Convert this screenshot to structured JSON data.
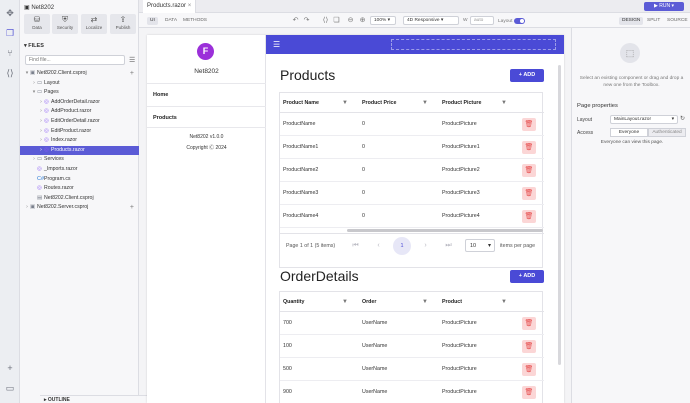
{
  "files_panel": {
    "project": "Net8202",
    "quick": [
      {
        "label": "Data",
        "icon": "database-icon"
      },
      {
        "label": "Security",
        "icon": "shield-icon"
      },
      {
        "label": "Localize",
        "icon": "translate-icon"
      },
      {
        "label": "Publish",
        "icon": "upload-icon"
      }
    ],
    "files_title": "FILES",
    "filter_placeholder": "Find file...",
    "tree": [
      {
        "label": "Net8202.Client.csproj",
        "indent": 0,
        "type": "proj",
        "chev": "▾",
        "plus": true
      },
      {
        "label": "Layout",
        "indent": 1,
        "type": "folder",
        "chev": "›"
      },
      {
        "label": "Pages",
        "indent": 1,
        "type": "folder",
        "chev": "▾"
      },
      {
        "label": "AddOrderDetail.razor",
        "indent": 2,
        "type": "razor",
        "chev": "›"
      },
      {
        "label": "AddProduct.razor",
        "indent": 2,
        "type": "razor",
        "chev": "›"
      },
      {
        "label": "EditOrderDetail.razor",
        "indent": 2,
        "type": "razor",
        "chev": "›"
      },
      {
        "label": "EditProduct.razor",
        "indent": 2,
        "type": "razor",
        "chev": "›"
      },
      {
        "label": "Index.razor",
        "indent": 2,
        "type": "razor",
        "chev": "›"
      },
      {
        "label": "Products.razor",
        "indent": 2,
        "type": "razor",
        "chev": "›",
        "selected": true
      },
      {
        "label": "Services",
        "indent": 1,
        "type": "folder",
        "chev": "›"
      },
      {
        "label": "_Imports.razor",
        "indent": 1,
        "type": "razor",
        "chev": ""
      },
      {
        "label": "Program.cs",
        "indent": 1,
        "type": "cs",
        "chev": ""
      },
      {
        "label": "Routes.razor",
        "indent": 1,
        "type": "razor",
        "chev": ""
      },
      {
        "label": "Net8202.Client.csproj",
        "indent": 1,
        "type": "file",
        "chev": ""
      },
      {
        "label": "Net8202.Server.csproj",
        "indent": 0,
        "type": "proj",
        "chev": "›",
        "plus": true
      }
    ],
    "outline_title": "OUTLINE"
  },
  "editor": {
    "tab": "Products.razor",
    "run_label": "RUN",
    "view_tabs": [
      "UI",
      "DATA",
      "METHODS"
    ],
    "zoom": "100%",
    "device": "4D Responsive",
    "width_label": "W",
    "width_value": "auto",
    "layout_label": "Layout"
  },
  "preview": {
    "app_name": "Net8202",
    "logo_letter": "F",
    "nav": [
      "Home",
      "Products"
    ],
    "version": "Net8202 v1.0.0",
    "copyright": "Copyright Ⓒ 2024",
    "products": {
      "title": "Products",
      "add_label": "ADD",
      "columns": [
        "Product Name",
        "Product Price",
        "Product Picture"
      ],
      "rows": [
        [
          "ProductName",
          "0",
          "ProductPicture"
        ],
        [
          "ProductName1",
          "0",
          "ProductPicture1"
        ],
        [
          "ProductName2",
          "0",
          "ProductPicture2"
        ],
        [
          "ProductName3",
          "0",
          "ProductPicture3"
        ],
        [
          "ProductName4",
          "0",
          "ProductPicture4"
        ]
      ],
      "pager_summary": "Page 1 of 1 (5 items)",
      "current_page": "1",
      "page_size": "10",
      "per_page_label": "items per page"
    },
    "orders": {
      "title": "OrderDetails",
      "add_label": "ADD",
      "columns": [
        "Quantity",
        "Order",
        "Product"
      ],
      "rows": [
        [
          "700",
          "UserName",
          "ProductPicture"
        ],
        [
          "100",
          "UserName",
          "ProductPicture"
        ],
        [
          "500",
          "UserName",
          "ProductPicture"
        ],
        [
          "900",
          "UserName",
          "ProductPicture"
        ]
      ]
    }
  },
  "right_panel": {
    "tabs": [
      "DESIGN",
      "SPLIT",
      "SOURCE"
    ],
    "empty_text": "Select an existing component or drag and drop a new one from the Toolbox.",
    "props_title": "Page properties",
    "layout_label": "Layout",
    "layout_value": "MainLayout.razor",
    "access_label": "Access",
    "access_options": [
      "Everyone",
      "Authenticated"
    ],
    "access_note": "Everyone can view this page."
  },
  "colors": {
    "accent": "#5b5bd6",
    "app_header": "#4a4ad6",
    "danger": "#e54b4b"
  }
}
